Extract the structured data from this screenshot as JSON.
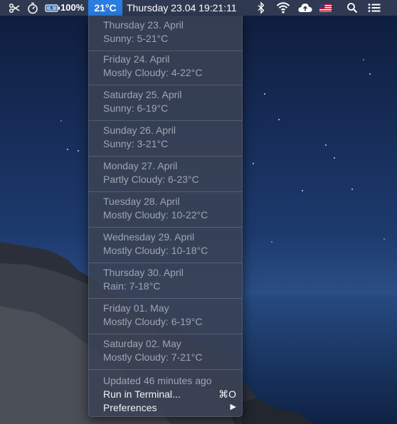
{
  "menubar": {
    "battery_percent": "100%",
    "temperature": "21°C",
    "clock": "Thursday 23.04  19:21:11",
    "icons": [
      "scissors-icon",
      "stopwatch-icon",
      "battery-icon",
      "bluetooth-icon",
      "wifi-icon",
      "cloud-upload-icon",
      "us-flag-icon",
      "search-icon",
      "list-icon"
    ]
  },
  "forecast": [
    {
      "date": "Thursday 23. April",
      "summary": "Sunny: 5-21°C"
    },
    {
      "date": "Friday 24. April",
      "summary": "Mostly Cloudy: 4-22°C"
    },
    {
      "date": "Saturday 25. April",
      "summary": "Sunny: 6-19°C"
    },
    {
      "date": "Sunday 26. April",
      "summary": "Sunny: 3-21°C"
    },
    {
      "date": "Monday 27. April",
      "summary": "Partly Cloudy: 6-23°C"
    },
    {
      "date": "Tuesday 28. April",
      "summary": "Mostly Cloudy: 10-22°C"
    },
    {
      "date": "Wednesday 29. April",
      "summary": "Mostly Cloudy: 10-18°C"
    },
    {
      "date": "Thursday 30. April",
      "summary": "Rain: 7-18°C"
    },
    {
      "date": "Friday 01. May",
      "summary": "Mostly Cloudy: 6-19°C"
    },
    {
      "date": "Saturday 02. May",
      "summary": "Mostly Cloudy: 7-21°C"
    }
  ],
  "footer": {
    "updated": "Updated 46 minutes ago",
    "run_terminal": "Run in Terminal...",
    "run_terminal_shortcut": "⌘O",
    "preferences": "Preferences",
    "preferences_arrow": "▶"
  },
  "colors": {
    "menubar": "#2f3a52",
    "highlight": "#2a7de1",
    "menu_bg": "#3a4254",
    "muted_text": "#9ea5b2"
  }
}
